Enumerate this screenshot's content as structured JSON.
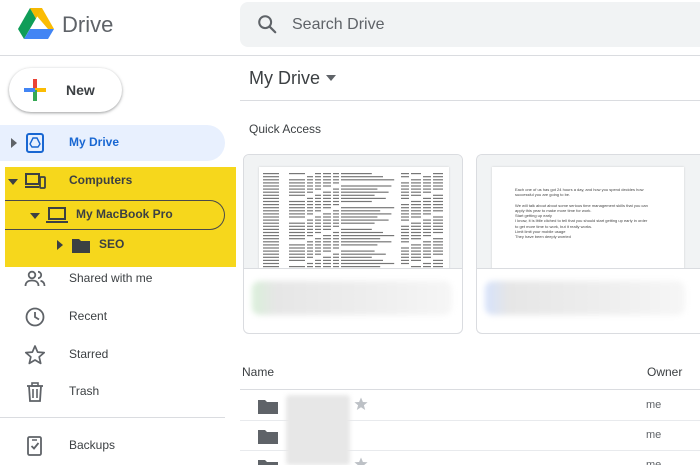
{
  "header": {
    "app_name": "Drive",
    "search_placeholder": "Search Drive"
  },
  "sidebar": {
    "new_label": "New",
    "items": [
      {
        "label": "My Drive",
        "icon": "my-drive-icon",
        "selected": true
      },
      {
        "label": "Computers",
        "icon": "computers-icon"
      },
      {
        "label": "My MacBook Pro",
        "icon": "laptop-icon"
      },
      {
        "label": "SEO",
        "icon": "folder-icon"
      },
      {
        "label": "Shared with me",
        "icon": "people-icon"
      },
      {
        "label": "Recent",
        "icon": "clock-icon"
      },
      {
        "label": "Starred",
        "icon": "star-icon"
      },
      {
        "label": "Trash",
        "icon": "trash-icon"
      },
      {
        "label": "Backups",
        "icon": "backups-icon"
      }
    ]
  },
  "main": {
    "title": "My Drive",
    "quick_access_title": "Quick Access",
    "doc_preview_lines": [
      "Each one of us has got 24 hours a day, and how you spend decides how",
      "successful you are going to be.",
      "",
      "We will talk about about some serious time management skills that you can",
      "apply this year to make more time for work.",
      "Start getting up early",
      "I know, it is little cliched to tell that you should start getting up early in order",
      "to get more time to work, but it really works.",
      "Limit limit your mobile usage",
      "They have been deeply worried"
    ],
    "list": {
      "col_name": "Name",
      "col_owner": "Owner",
      "rows": [
        {
          "owner": "me"
        },
        {
          "owner": "me"
        },
        {
          "owner": "me"
        }
      ]
    }
  },
  "colors": {
    "accent": "#1967d2",
    "selected_bg": "#e8f0fe",
    "highlight": "#f6d71c",
    "icon_grey": "#5f6368"
  }
}
